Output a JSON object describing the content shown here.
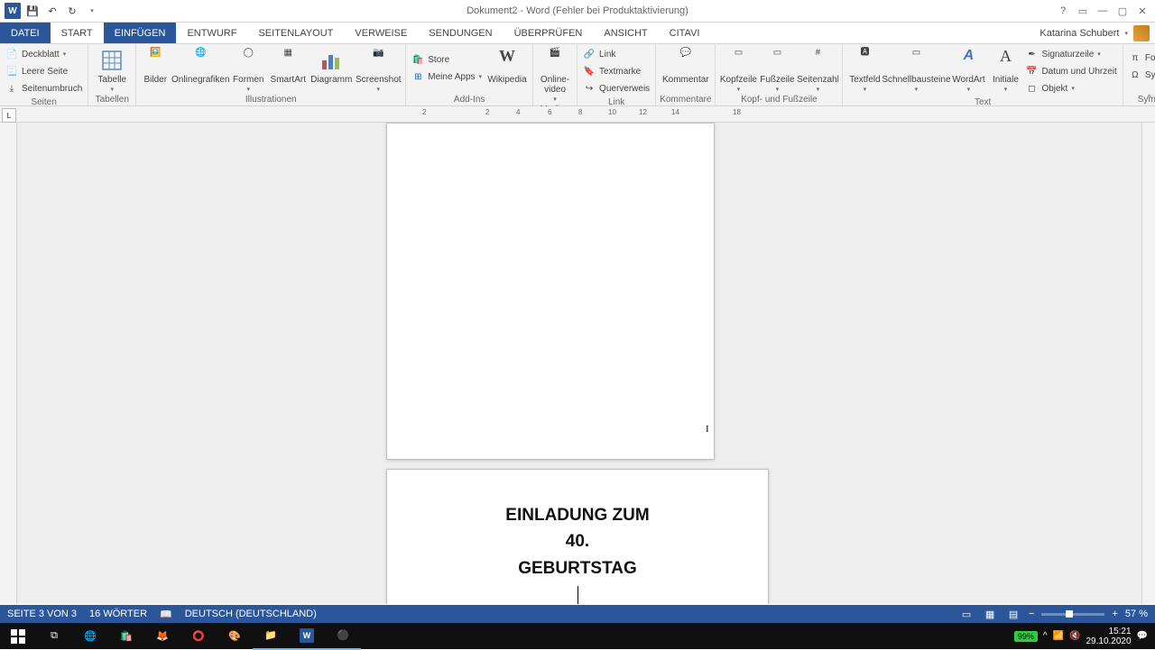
{
  "title": "Dokument2 - Word (Fehler bei Produktaktivierung)",
  "user": "Katarina Schubert",
  "tabs": {
    "datei": "DATEI",
    "start": "START",
    "einfuegen": "EINFÜGEN",
    "entwurf": "ENTWURF",
    "seitenlayout": "SEITENLAYOUT",
    "verweise": "VERWEISE",
    "sendungen": "SENDUNGEN",
    "ueberpruefen": "ÜBERPRÜFEN",
    "ansicht": "ANSICHT",
    "citavi": "CITAVI"
  },
  "ribbon": {
    "seiten": {
      "label": "Seiten",
      "deckblatt": "Deckblatt",
      "leere": "Leere Seite",
      "seitenumbruch": "Seitenumbruch"
    },
    "tabellen": {
      "label": "Tabellen",
      "tabelle": "Tabelle"
    },
    "illustrationen": {
      "label": "Illustrationen",
      "bilder": "Bilder",
      "onlinegrafiken": "Onlinegrafiken",
      "formen": "Formen",
      "smartart": "SmartArt",
      "diagramm": "Diagramm",
      "screenshot": "Screenshot"
    },
    "addins": {
      "label": "Add-Ins",
      "store": "Store",
      "meineapps": "Meine Apps",
      "wikipedia": "Wikipedia"
    },
    "medien": {
      "label": "Medien",
      "onlinevideo": "Online-video"
    },
    "link": {
      "label": "Link",
      "link": "Link",
      "textmarke": "Textmarke",
      "querverweis": "Querverweis"
    },
    "kommentare": {
      "label": "Kommentare",
      "kommentar": "Kommentar"
    },
    "kopf": {
      "label": "Kopf- und Fußzeile",
      "kopfzeile": "Kopfzeile",
      "fusszeile": "Fußzeile",
      "seitenzahl": "Seitenzahl"
    },
    "text": {
      "label": "Text",
      "textfeld": "Textfeld",
      "schnellbausteine": "Schnellbausteine",
      "wordart": "WordArt",
      "initiale": "Initiale",
      "signatur": "Signaturzeile",
      "datum": "Datum und Uhrzeit",
      "objekt": "Objekt"
    },
    "symbole": {
      "label": "Symbole",
      "formel": "Formel",
      "symbol": "Symbol"
    }
  },
  "ruler": {
    "marks": [
      "2",
      "2",
      "4",
      "6",
      "8",
      "10",
      "12",
      "14",
      "18"
    ]
  },
  "document": {
    "line1": "EINLADUNG ZUM",
    "line2": "40.",
    "line3": "GEBURTSTAG"
  },
  "status": {
    "page": "SEITE 3 VON 3",
    "words": "16 WÖRTER",
    "lang": "DEUTSCH (DEUTSCHLAND)",
    "zoom": "57 %"
  },
  "systray": {
    "battery": "99%",
    "time": "15:21",
    "date": "29.10.2020"
  }
}
